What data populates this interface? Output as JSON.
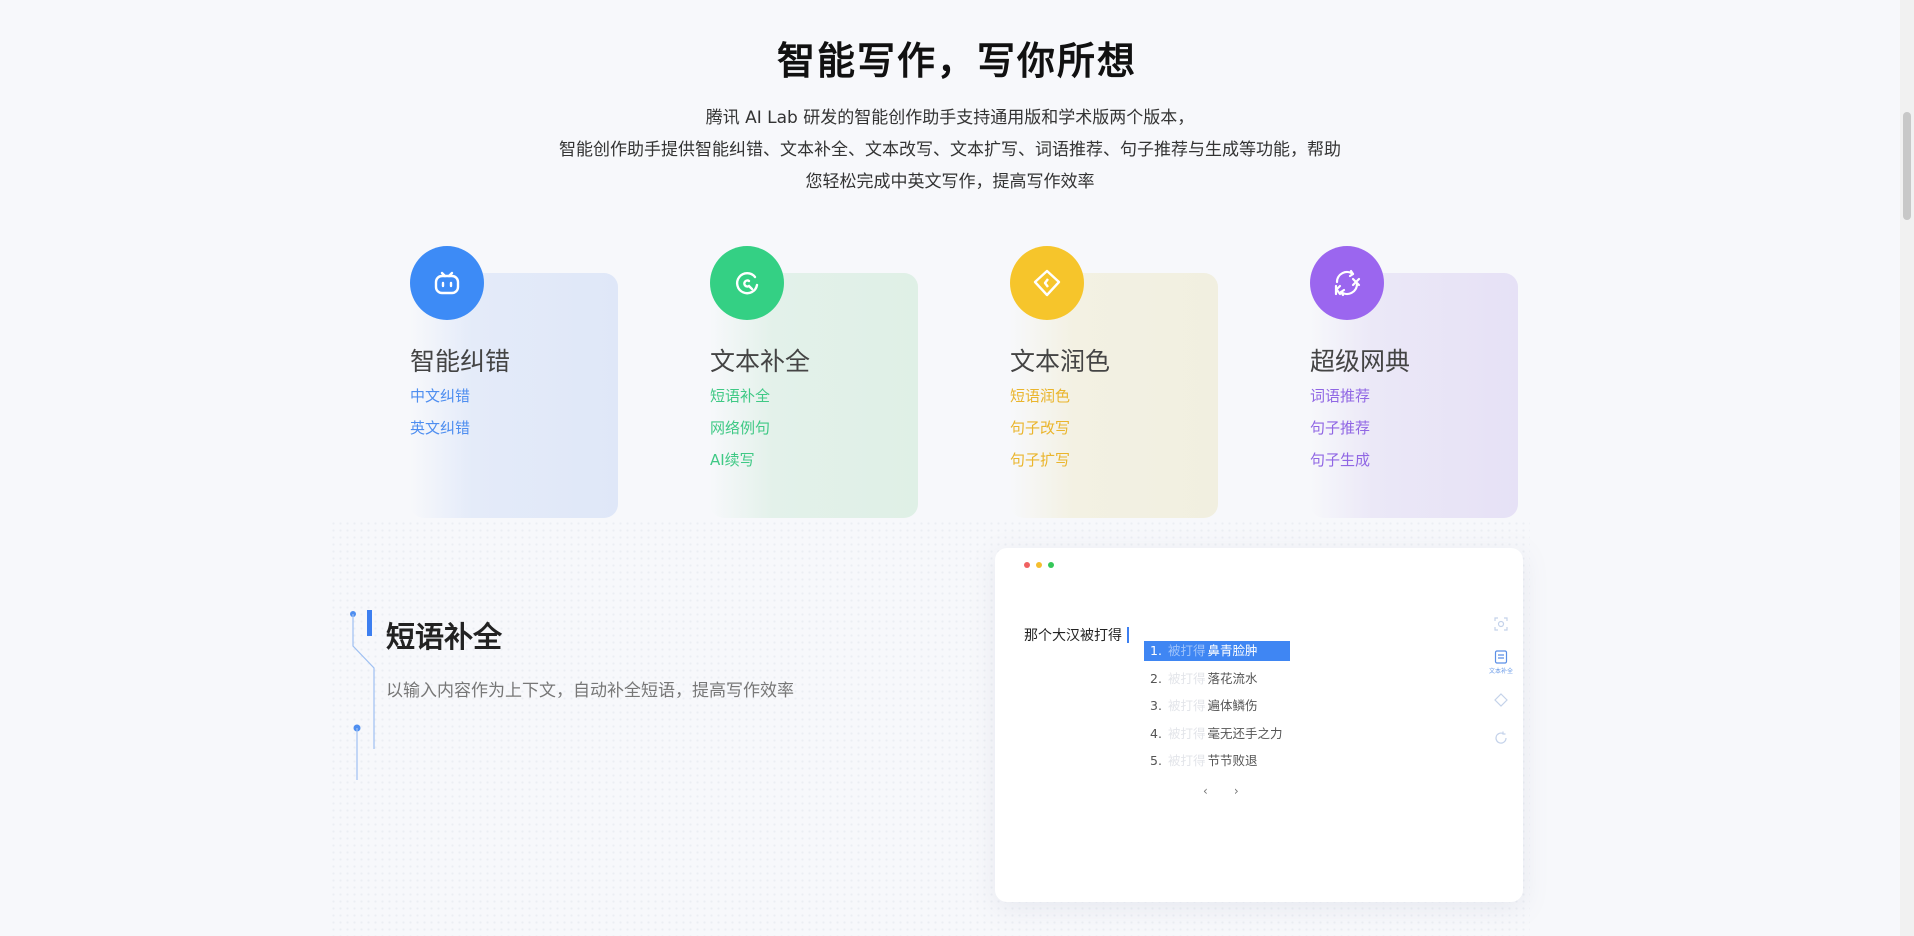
{
  "title": "智能写作，写你所想",
  "subtitle": [
    "腾讯 AI Lab 研发的智能创作助手支持通用版和学术版两个版本，",
    "智能创作助手提供智能纠错、文本补全、文本改写、文本扩写、词语推荐、句子推荐与生成等功能，帮助",
    "您轻松完成中英文写作，提高写作效率"
  ],
  "features": [
    {
      "title": "智能纠错",
      "icon": "robot-face-icon",
      "accent": "#3d8bf6",
      "links": [
        "中文纠错",
        "英文纠错"
      ]
    },
    {
      "title": "文本补全",
      "icon": "refresh-circle-icon",
      "accent": "#34d084",
      "links": [
        "短语补全",
        "网络例句",
        "AI续写"
      ]
    },
    {
      "title": "文本润色",
      "icon": "diamond-icon",
      "accent": "#f6c52b",
      "links": [
        "短语润色",
        "句子改写",
        "句子扩写"
      ]
    },
    {
      "title": "超级网典",
      "icon": "translate-swap-icon",
      "accent": "#9b66ef",
      "links": [
        "词语推荐",
        "句子推荐",
        "句子生成"
      ]
    }
  ],
  "highlight": {
    "title": "短语补全",
    "description": "以输入内容作为上下文，自动补全短语，提高写作效率"
  },
  "demo": {
    "input_text": "那个大汉被打得",
    "suggestions": [
      {
        "num": "1.",
        "ghost": "被打得",
        "text": "鼻青脸肿"
      },
      {
        "num": "2.",
        "ghost": "被打得",
        "text": "落花流水"
      },
      {
        "num": "3.",
        "ghost": "被打得",
        "text": "遍体鳞伤"
      },
      {
        "num": "4.",
        "ghost": "被打得",
        "text": "毫无还手之力"
      },
      {
        "num": "5.",
        "ghost": "被打得",
        "text": "节节败退"
      }
    ],
    "pager": {
      "prev": "‹",
      "next": "›"
    },
    "active_tool_label": "文本补全"
  }
}
